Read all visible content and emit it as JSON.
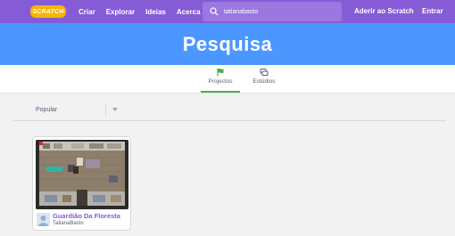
{
  "header": {
    "logo_text": "SCRATCH",
    "nav": [
      "Criar",
      "Explorar",
      "Ideias",
      "Acerca"
    ],
    "search_value": "tatianabasto",
    "join_label": "Aderir ao Scratch",
    "signin_label": "Entrar"
  },
  "hero": {
    "title": "Pesquisa"
  },
  "tabs": [
    {
      "label": "Projectos",
      "icon": "flag-icon",
      "active": true
    },
    {
      "label": "Estúdios",
      "icon": "studio-icon",
      "active": false
    }
  ],
  "filter": {
    "selected": "Popular"
  },
  "results": [
    {
      "title": "Guardião Da Floresta",
      "author": "TatianaBasto"
    }
  ],
  "colors": {
    "header": "#855cd6",
    "hero": "#4c97ff",
    "tab_active": "#4caf50",
    "title": "#855cd6"
  }
}
